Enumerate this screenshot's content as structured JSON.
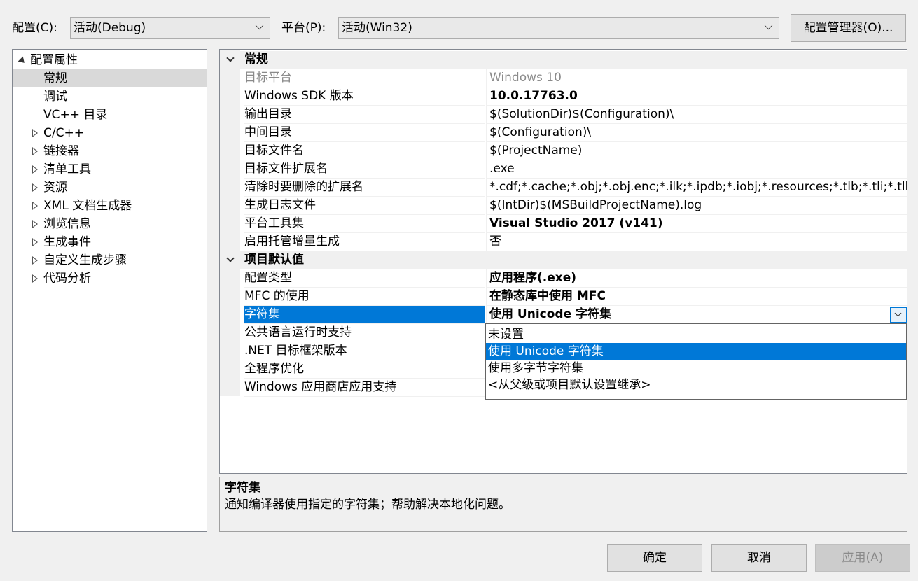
{
  "toolbar": {
    "config_label": "配置(C):",
    "config_value": "活动(Debug)",
    "platform_label": "平台(P):",
    "platform_value": "活动(Win32)",
    "config_manager_label": "配置管理器(O)..."
  },
  "tree": {
    "root": "配置属性",
    "items": [
      "常规",
      "调试",
      "VC++ 目录",
      "C/C++",
      "链接器",
      "清单工具",
      "资源",
      "XML 文档生成器",
      "浏览信息",
      "生成事件",
      "自定义生成步骤",
      "代码分析"
    ]
  },
  "grid": {
    "cat1": "常规",
    "cat2": "项目默认值",
    "props": [
      {
        "name": "目标平台",
        "value": "Windows 10"
      },
      {
        "name": "Windows SDK 版本",
        "value": "10.0.17763.0"
      },
      {
        "name": "输出目录",
        "value": "$(SolutionDir)$(Configuration)\\"
      },
      {
        "name": "中间目录",
        "value": "$(Configuration)\\"
      },
      {
        "name": "目标文件名",
        "value": "$(ProjectName)"
      },
      {
        "name": "目标文件扩展名",
        "value": ".exe"
      },
      {
        "name": "清除时要删除的扩展名",
        "value": "*.cdf;*.cache;*.obj;*.obj.enc;*.ilk;*.ipdb;*.iobj;*.resources;*.tlb;*.tli;*.tlh;*.tmp;*.rsp"
      },
      {
        "name": "生成日志文件",
        "value": "$(IntDir)$(MSBuildProjectName).log"
      },
      {
        "name": "平台工具集",
        "value": "Visual Studio 2017 (v141)"
      },
      {
        "name": "启用托管增量生成",
        "value": "否"
      },
      {
        "name": "配置类型",
        "value": "应用程序(.exe)"
      },
      {
        "name": "MFC 的使用",
        "value": "在静态库中使用 MFC"
      },
      {
        "name": "字符集",
        "value": "使用 Unicode 字符集"
      },
      {
        "name": "公共语言运行时支持",
        "value": ""
      },
      {
        "name": ".NET 目标框架版本",
        "value": ""
      },
      {
        "name": "全程序优化",
        "value": ""
      },
      {
        "name": "Windows 应用商店应用支持",
        "value": ""
      }
    ]
  },
  "dropdown": {
    "options": [
      "未设置",
      "使用 Unicode 字符集",
      "使用多字节字符集",
      "<从父级或项目默认设置继承>"
    ]
  },
  "description": {
    "title": "字符集",
    "text": "通知编译器使用指定的字符集；帮助解决本地化问题。"
  },
  "buttons": {
    "ok": "确定",
    "cancel": "取消",
    "apply": "应用(A)"
  },
  "colors": {
    "selection": "#0078d7",
    "tree_selection": "#d9d9d9",
    "disabled_text": "#8a8a8a"
  }
}
